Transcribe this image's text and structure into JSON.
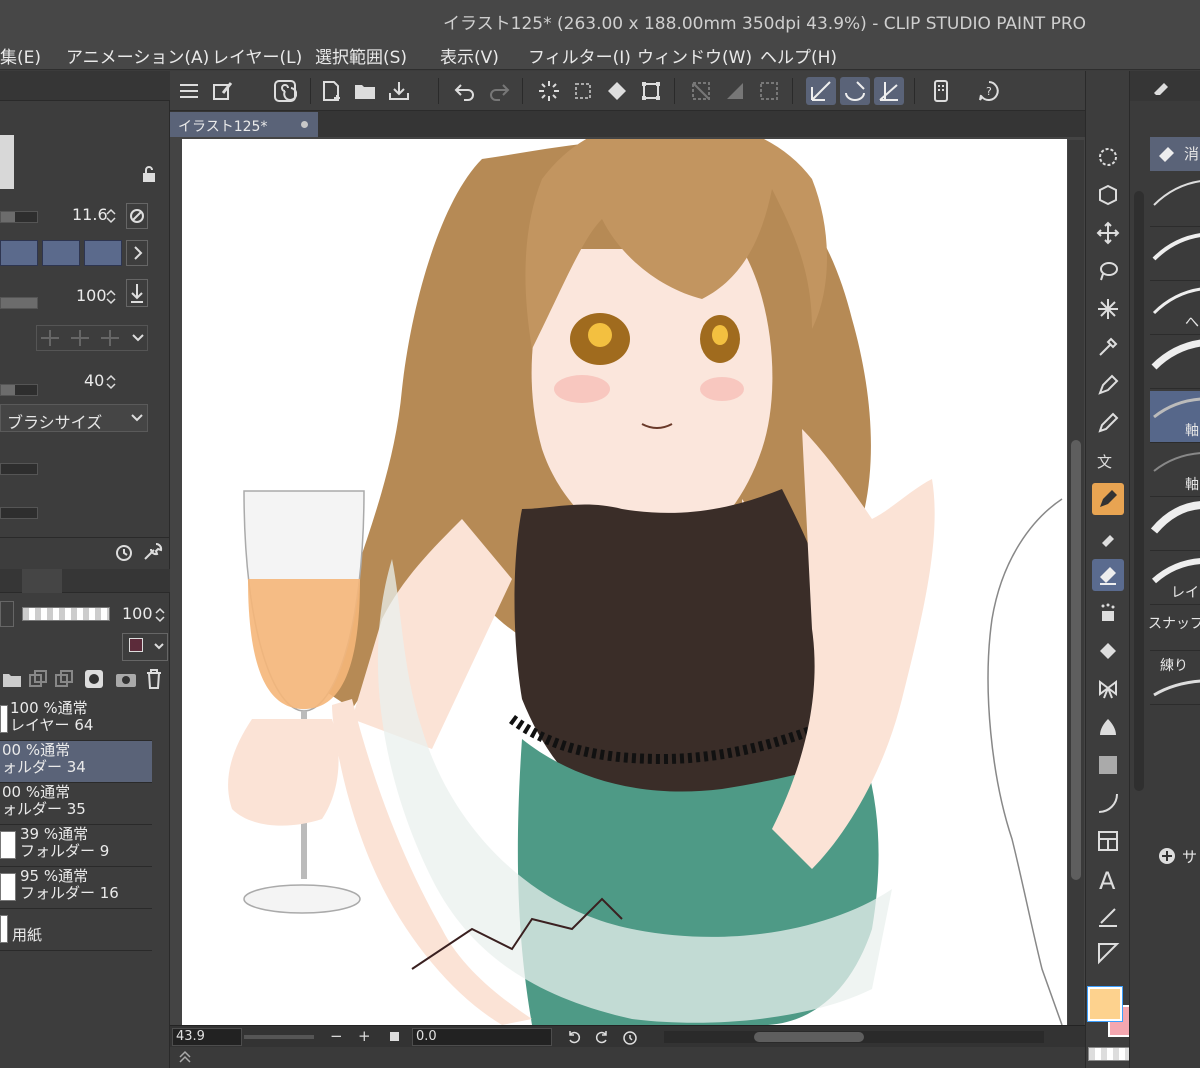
{
  "window": {
    "title": "イラスト125* (263.00 x 188.00mm 350dpi 43.9%)  - CLIP STUDIO PAINT PRO"
  },
  "menu": [
    "集(E)",
    "アニメーション(A)",
    "レイヤー(L)",
    "選択範囲(S)",
    "表示(V)",
    "フィルター(I)",
    "ウィンドウ(W)",
    "ヘルプ(H)"
  ],
  "document_tab": {
    "label": "イラスト125*"
  },
  "tool_property": {
    "brush_size": "11.6",
    "opacity": "100",
    "third_value": "40",
    "pressure_dropdown": "ブラシサイズ"
  },
  "layer_panel": {
    "opacity": "100",
    "layers": [
      {
        "line1": "100 %通常",
        "line2": "レイヤー 64",
        "selected": false
      },
      {
        "line1": "00 %通常",
        "line2": "ォルダー 34",
        "selected": true
      },
      {
        "line1": "00 %通常",
        "line2": "ォルダー 35",
        "selected": false
      },
      {
        "line1": "39 %通常",
        "line2": "フォルダー 9",
        "selected": false
      },
      {
        "line1": "95 %通常",
        "line2": "フォルダー 16",
        "selected": false
      },
      {
        "line1": "",
        "line2": "用紙",
        "selected": false
      }
    ]
  },
  "status": {
    "zoom": "43.9",
    "angle": "0.0"
  },
  "sub_tool": {
    "header": "消",
    "brushes": [
      {
        "label": ""
      },
      {
        "label": ""
      },
      {
        "label": "へ"
      },
      {
        "label": ""
      },
      {
        "label": "軸"
      },
      {
        "label": "軸"
      },
      {
        "label": ""
      },
      {
        "label": "レイ"
      },
      {
        "label": "スナップ"
      },
      {
        "label": "練り"
      }
    ],
    "add_label": "サ"
  },
  "colors": {
    "main_color": "#fdd28e",
    "sub_color": "#f4a7b0",
    "accent": "#5a6378",
    "hair": "#b68a55",
    "dress": "#4e9a86",
    "wine": "#f5b679"
  }
}
